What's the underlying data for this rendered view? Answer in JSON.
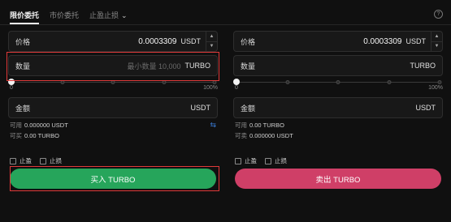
{
  "tabs": [
    {
      "label": "限价委托"
    },
    {
      "label": "市价委托"
    },
    {
      "label": "止盈止损"
    }
  ],
  "help_icon": "?",
  "buy": {
    "price": {
      "label": "价格",
      "value": "0.0003309",
      "unit": "USDT"
    },
    "quantity": {
      "label": "数量",
      "placeholder": "最小数量 10,000",
      "unit": "TURBO"
    },
    "slider": {
      "value_percent": 0,
      "min_label": "0",
      "max_label": "100%"
    },
    "amount": {
      "label": "金额",
      "unit": "USDT"
    },
    "available": {
      "label": "可用",
      "value": "0.000000 USDT"
    },
    "can_trade": {
      "label": "可买",
      "value": "0.00 TURBO"
    },
    "take_profit": "止盈",
    "stop_loss": "止损",
    "button": "买入 TURBO"
  },
  "sell": {
    "price": {
      "label": "价格",
      "value": "0.0003309",
      "unit": "USDT"
    },
    "quantity": {
      "label": "数量",
      "unit": "TURBO"
    },
    "slider": {
      "value_percent": 0,
      "min_label": "0",
      "max_label": "100%"
    },
    "amount": {
      "label": "金额",
      "unit": "USDT"
    },
    "available": {
      "label": "可用",
      "value": "0.00 TURBO"
    },
    "can_trade": {
      "label": "可卖",
      "value": "0.000000 USDT"
    },
    "take_profit": "止盈",
    "stop_loss": "止损",
    "button": "卖出 TURBO"
  },
  "colors": {
    "buy": "#26a55b",
    "sell": "#cf3f67",
    "highlight": "#e03a3a",
    "swap_icon": "#3a7bd5"
  },
  "icons": {
    "dropdown": "chevron-down-icon",
    "help": "help-icon",
    "swap": "swap-icon",
    "stepper_up": "caret-up-icon",
    "stepper_down": "caret-down-icon"
  }
}
